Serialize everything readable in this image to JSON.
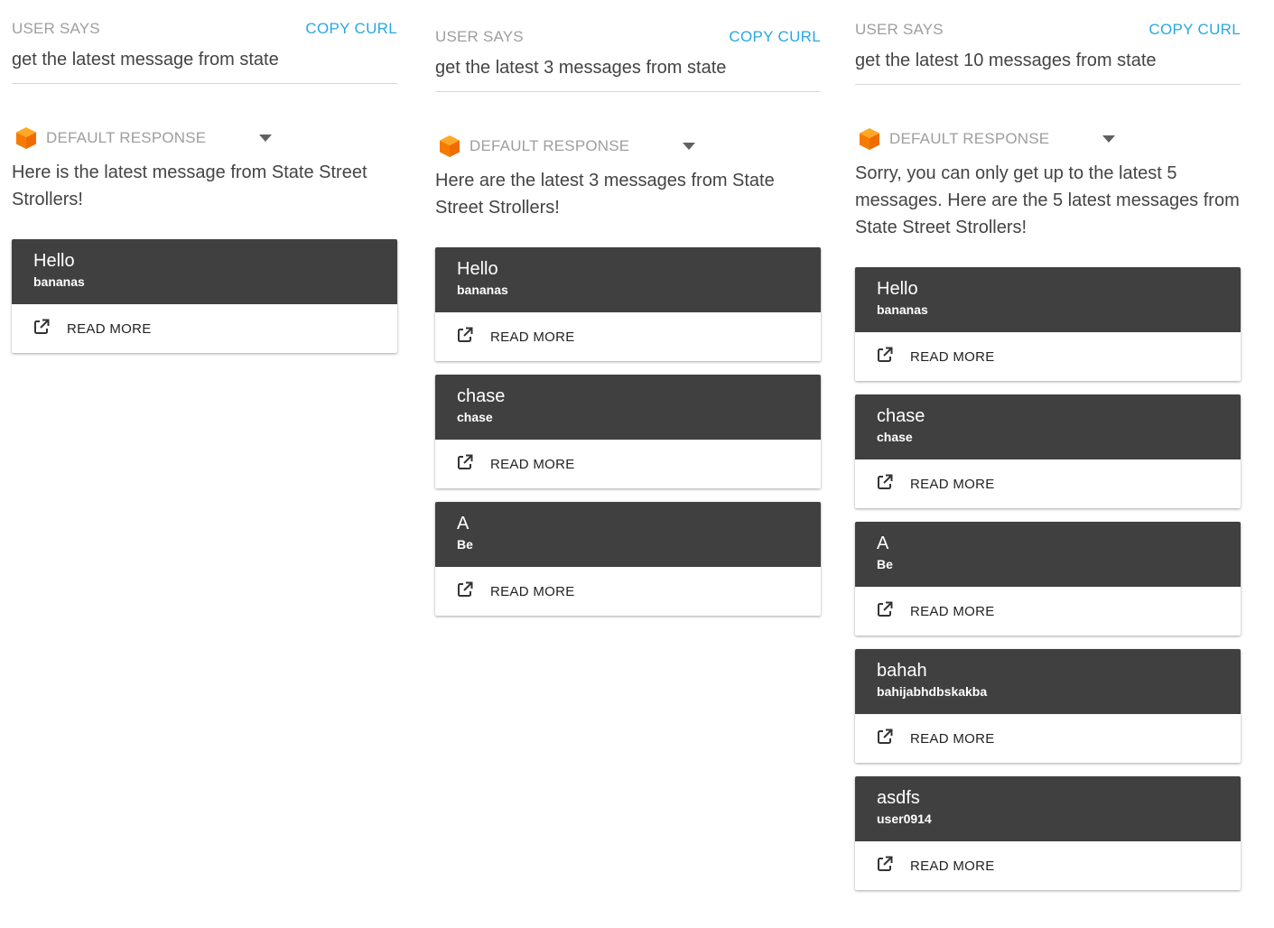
{
  "columns": [
    {
      "user_says_label": "USER SAYS",
      "copy_curl_label": "COPY CURL",
      "query": "get the latest message from state",
      "response_label": "DEFAULT RESPONSE",
      "response_text": "Here is the latest message from State Street Strollers!",
      "cards": [
        {
          "title": "Hello",
          "subtitle": "bananas",
          "action": "READ MORE"
        }
      ]
    },
    {
      "user_says_label": "USER SAYS",
      "copy_curl_label": "COPY CURL",
      "query": "get the latest 3 messages from state",
      "response_label": "DEFAULT RESPONSE",
      "response_text": "Here are the latest 3 messages from State Street Strollers!",
      "cards": [
        {
          "title": "Hello",
          "subtitle": "bananas",
          "action": "READ MORE"
        },
        {
          "title": "chase",
          "subtitle": "chase",
          "action": "READ MORE"
        },
        {
          "title": "A",
          "subtitle": "Be",
          "action": "READ MORE"
        }
      ]
    },
    {
      "user_says_label": "USER SAYS",
      "copy_curl_label": "COPY CURL",
      "query": "get the latest 10 messages from state",
      "response_label": "DEFAULT RESPONSE",
      "response_text": "Sorry, you can only get up to the latest 5 messages. Here are the 5 latest messages from State Street Strollers!",
      "cards": [
        {
          "title": "Hello",
          "subtitle": "bananas",
          "action": "READ MORE"
        },
        {
          "title": "chase",
          "subtitle": "chase",
          "action": "READ MORE"
        },
        {
          "title": "A",
          "subtitle": "Be",
          "action": "READ MORE"
        },
        {
          "title": "bahah",
          "subtitle": "bahijabhdbskakba",
          "action": "READ MORE"
        },
        {
          "title": "asdfs",
          "subtitle": "user0914",
          "action": "READ MORE"
        }
      ]
    }
  ],
  "colors": {
    "accent": "#29a8e0",
    "card_header": "#404040",
    "response_icon": "#f57c00"
  },
  "icons": {
    "response": "orange-cube-icon",
    "card_action": "external-link-icon",
    "dropdown": "caret-down-icon"
  }
}
